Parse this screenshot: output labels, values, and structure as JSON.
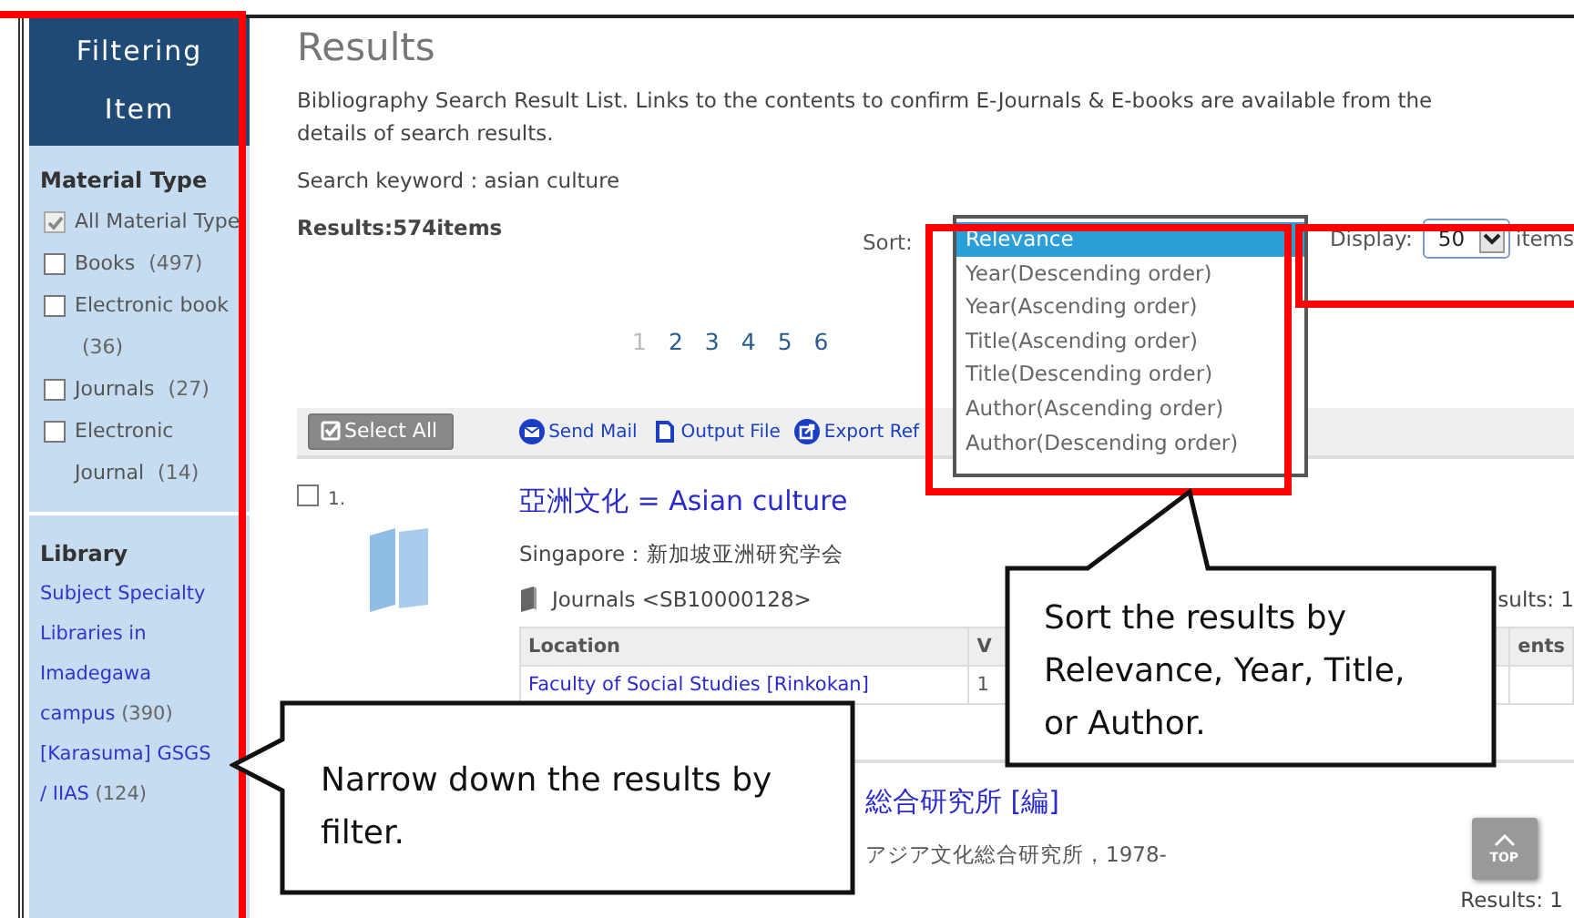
{
  "sidebar": {
    "header": "Filtering Item",
    "material_type": {
      "title": "Material Type",
      "options": [
        {
          "label": "All Material Type",
          "checked": true
        },
        {
          "label": "Books",
          "count": "(497)",
          "checked": false
        },
        {
          "label": "Electronic book",
          "count": "(36)",
          "checked": false
        },
        {
          "label": "Journals",
          "count": "(27)",
          "checked": false
        },
        {
          "label": "Electronic Journal",
          "count": "(14)",
          "checked": false
        }
      ]
    },
    "library": {
      "title": "Library",
      "items": [
        {
          "label": "Subject Specialty Libraries in Imadegawa campus",
          "count": "(390)"
        },
        {
          "label": "[Karasuma] GSGS / IIAS",
          "count": "(124)"
        }
      ]
    }
  },
  "main": {
    "title": "Results",
    "description": "Bibliography Search Result List. Links to the contents to confirm E-Journals & E-books are available from the details of search results.",
    "keyword": "Search keyword : asian culture",
    "results_count": "Results:574items",
    "sort": {
      "label": "Sort:",
      "options": [
        {
          "label": "Relevance",
          "selected": true
        },
        {
          "label": "Year(Descending order)",
          "selected": false
        },
        {
          "label": "Year(Ascending order)",
          "selected": false
        },
        {
          "label": "Title(Ascending order)",
          "selected": false
        },
        {
          "label": "Title(Descending order)",
          "selected": false
        },
        {
          "label": "Author(Ascending order)",
          "selected": false
        },
        {
          "label": "Author(Descending order)",
          "selected": false
        }
      ]
    },
    "display": {
      "label": "Display:",
      "value": "50",
      "unit": "items"
    },
    "pagination": [
      {
        "label": "1",
        "selected": true
      },
      {
        "label": "2",
        "selected": false
      },
      {
        "label": "3",
        "selected": false
      },
      {
        "label": "4",
        "selected": false
      },
      {
        "label": "5",
        "selected": false
      },
      {
        "label": "6",
        "selected": false
      }
    ],
    "toolbar": {
      "select_all": "Select All",
      "actions": [
        {
          "kind": "mail",
          "label": "Send Mail"
        },
        {
          "kind": "file",
          "label": "Output File"
        },
        {
          "kind": "export",
          "label": "Export Ref"
        }
      ]
    },
    "results": [
      {
        "number": "1.",
        "checked": false,
        "title": "亞洲文化 = Asian culture",
        "publisher": "Singapore：新加坡亚洲研究学会",
        "type": "Journals <SB10000128>",
        "holdings": "sults: 1",
        "table": {
          "columns": [
            "Location",
            "V",
            "ents"
          ],
          "rows": [
            [
              "Faculty of Social Studies [Rinkokan]",
              "1",
              ""
            ]
          ]
        }
      },
      {
        "title": "総合研究所 [編]",
        "publisher": "アジア文化総合研究所，1978-",
        "holdings": "Results: 1"
      }
    ],
    "top_button": "TOP"
  },
  "callouts": [
    {
      "kind": "left",
      "text": "Narrow down the results by filter."
    },
    {
      "kind": "up",
      "text": "Sort the results by Relevance, Year, Title, or Author."
    }
  ]
}
